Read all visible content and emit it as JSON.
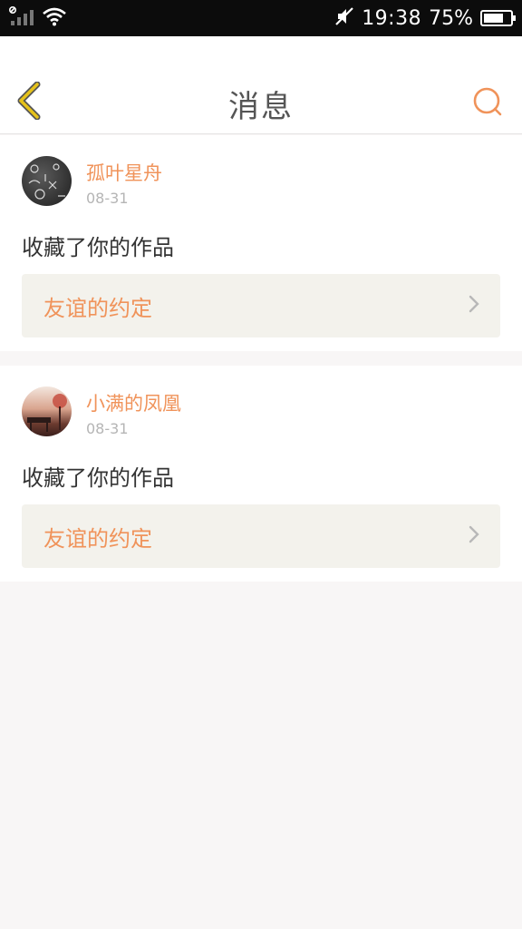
{
  "statusbar": {
    "time": "19:38",
    "battery_percent_text": "75%",
    "battery_level": 0.75,
    "icons": [
      "signal-icon",
      "wifi-icon",
      "mute-icon",
      "battery-icon"
    ]
  },
  "header": {
    "title": "消息",
    "back_icon": "back-chevron-icon",
    "search_icon": "search-icon"
  },
  "colors": {
    "accent": "#f0935a",
    "back_icon": "#e6c21a",
    "work_box_bg": "#f3f2ec",
    "page_bg": "#f8f6f6"
  },
  "messages": [
    {
      "username": "孤叶星舟",
      "date": "08-31",
      "action": "收藏了你的作品",
      "work_title": "友谊的约定"
    },
    {
      "username": "小满的凤凰",
      "date": "08-31",
      "action": "收藏了你的作品",
      "work_title": "友谊的约定"
    }
  ]
}
